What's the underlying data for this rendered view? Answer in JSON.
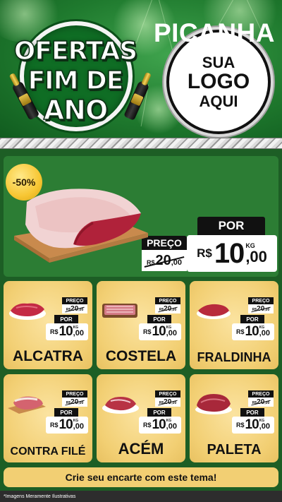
{
  "header": {
    "badge_lines": [
      "OFERTAS",
      "FIM DE",
      "ANO"
    ],
    "logo_lines": [
      "SUA",
      "LOGO",
      "AQUI"
    ]
  },
  "hero": {
    "product": "PICANHA",
    "discount": "-50%",
    "preco_label": "PREÇO",
    "por_label": "POR",
    "old_price": {
      "currency": "R$",
      "integer": "20",
      "cents": ",00"
    },
    "new_price": {
      "currency": "R$",
      "integer": "10",
      "cents": ",00",
      "unit": "KG"
    }
  },
  "products": [
    {
      "name": "ALCATRA"
    },
    {
      "name": "COSTELA"
    },
    {
      "name": "FRALDINHA"
    },
    {
      "name": "CONTRA FILÉ"
    },
    {
      "name": "ACÉM"
    },
    {
      "name": "PALETA"
    }
  ],
  "product_price": {
    "preco_label": "PREÇO",
    "por_label": "POR",
    "old": {
      "currency": "R$",
      "integer": "20",
      "cents": ",00"
    },
    "new": {
      "currency": "R$",
      "integer": "10",
      "cents": ",00",
      "unit": "KG"
    }
  },
  "footer": {
    "cta": "Crie seu encarte com este tema!",
    "note": "*Imagens Meramente Ilustrativas"
  },
  "colors": {
    "header_green": "#1f7a2e",
    "hero_green": "#2c7d34",
    "card_yellow": "#f2cf73",
    "tag_black": "#111111"
  }
}
